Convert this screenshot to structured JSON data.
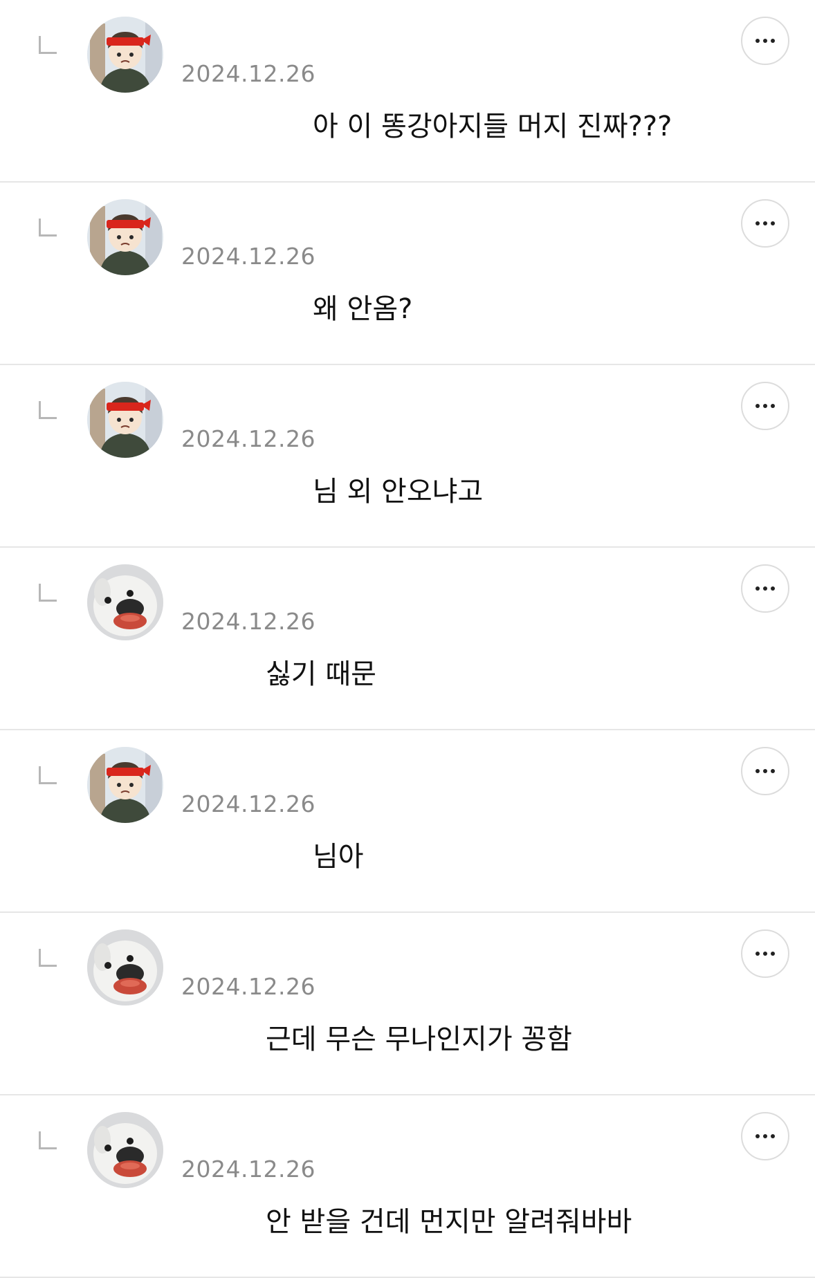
{
  "comments": [
    {
      "avatar": "boy-avatar-icon",
      "date": "2024.12.26",
      "text": "아 이 똥강아지들 머지 진짜???"
    },
    {
      "avatar": "boy-avatar-icon",
      "date": "2024.12.26",
      "text": "왜 안옴?"
    },
    {
      "avatar": "boy-avatar-icon",
      "date": "2024.12.26",
      "text": "님 외 안오냐고"
    },
    {
      "avatar": "dog-avatar-icon",
      "date": "2024.12.26",
      "text": "싫기 때문"
    },
    {
      "avatar": "boy-avatar-icon",
      "date": "2024.12.26",
      "text": "님아"
    },
    {
      "avatar": "dog-avatar-icon",
      "date": "2024.12.26",
      "text": "근데 무슨 무나인지가 꽁함"
    },
    {
      "avatar": "dog-avatar-icon",
      "date": "2024.12.26",
      "text": "안 받을 건데 먼지만 알려줘바바"
    }
  ],
  "more_icon": "more-horizontal-icon",
  "reply_icon": "reply-indicator-icon",
  "colors": {
    "divider": "#e6e6e6",
    "date": "#8a8a8a",
    "text": "#111111",
    "headband": "#d9261c"
  }
}
